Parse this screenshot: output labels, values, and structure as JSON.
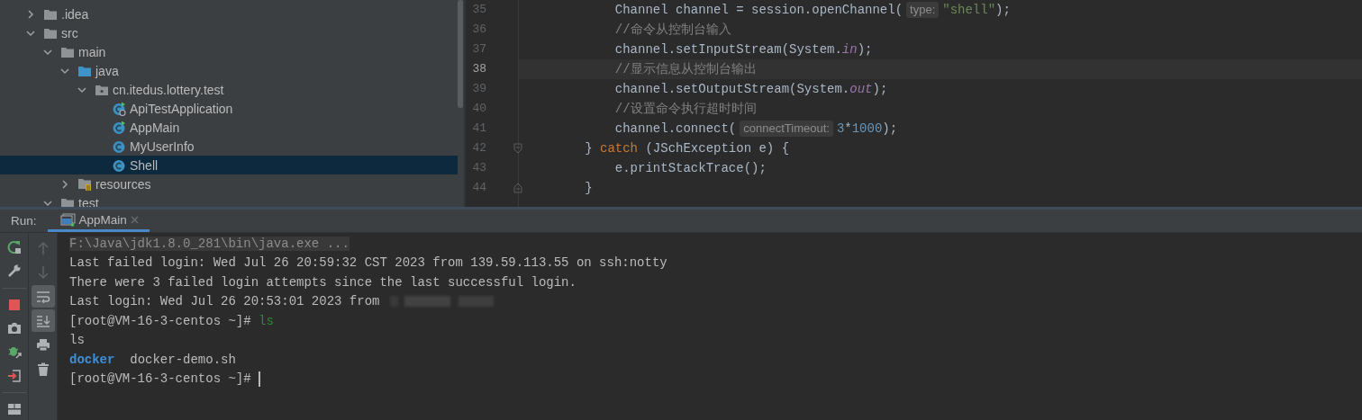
{
  "project_tree": [
    {
      "name": ".idea",
      "kind": "folder",
      "expanded": false,
      "selected": false
    },
    {
      "name": "src",
      "kind": "folder",
      "expanded": true,
      "selected": false,
      "children": [
        {
          "name": "main",
          "kind": "folder",
          "expanded": true,
          "selected": false,
          "children": [
            {
              "name": "java",
              "kind": "source-folder",
              "expanded": true,
              "selected": false,
              "children": [
                {
                  "name": "cn.itedus.lottery.test",
                  "kind": "package",
                  "expanded": true,
                  "selected": false,
                  "children": [
                    {
                      "name": "ApiTestApplication",
                      "kind": "spring-main-class",
                      "selected": false
                    },
                    {
                      "name": "AppMain",
                      "kind": "main-class",
                      "selected": false
                    },
                    {
                      "name": "MyUserInfo",
                      "kind": "class",
                      "selected": false
                    },
                    {
                      "name": "Shell",
                      "kind": "class",
                      "selected": true
                    }
                  ]
                }
              ]
            },
            {
              "name": "resources",
              "kind": "resources-folder",
              "expanded": false,
              "selected": false
            }
          ]
        },
        {
          "name": "test",
          "kind": "folder",
          "expanded": true,
          "selected": false
        }
      ]
    }
  ],
  "editor": {
    "lines": [
      {
        "number": "35",
        "current": false,
        "segments": [
          {
            "kind": "plain",
            "text": "            Channel channel = session.openChannel("
          },
          {
            "kind": "hint",
            "text": "type:"
          },
          {
            "kind": "string",
            "text": "\"shell\""
          },
          {
            "kind": "plain",
            "text": ");"
          }
        ]
      },
      {
        "number": "36",
        "current": false,
        "segments": [
          {
            "kind": "comment",
            "text": "            //命令从控制台输入"
          }
        ]
      },
      {
        "number": "37",
        "current": false,
        "segments": [
          {
            "kind": "plain",
            "text": "            channel.setInputStream(System."
          },
          {
            "kind": "field",
            "text": "in"
          },
          {
            "kind": "plain",
            "text": ");"
          }
        ]
      },
      {
        "number": "38",
        "current": true,
        "segments": [
          {
            "kind": "comment",
            "text": "            //显示信息从控制台输出"
          }
        ]
      },
      {
        "number": "39",
        "current": false,
        "segments": [
          {
            "kind": "plain",
            "text": "            channel.setOutputStream(System."
          },
          {
            "kind": "field",
            "text": "out"
          },
          {
            "kind": "plain",
            "text": ");"
          }
        ]
      },
      {
        "number": "40",
        "current": false,
        "segments": [
          {
            "kind": "comment",
            "text": "            //设置命令执行超时时间"
          }
        ]
      },
      {
        "number": "41",
        "current": false,
        "segments": [
          {
            "kind": "plain",
            "text": "            channel.connect("
          },
          {
            "kind": "hint",
            "text": "connectTimeout:"
          },
          {
            "kind": "number",
            "text": "3"
          },
          {
            "kind": "plain",
            "text": "*"
          },
          {
            "kind": "number",
            "text": "1000"
          },
          {
            "kind": "plain",
            "text": ");"
          }
        ]
      },
      {
        "number": "42",
        "current": false,
        "fold_start": true,
        "segments": [
          {
            "kind": "plain",
            "text": "        } "
          },
          {
            "kind": "keyword",
            "text": "catch"
          },
          {
            "kind": "plain",
            "text": " (JSchException e) {"
          }
        ]
      },
      {
        "number": "43",
        "current": false,
        "segments": [
          {
            "kind": "plain",
            "text": "            e.printStackTrace();"
          }
        ]
      },
      {
        "number": "44",
        "current": false,
        "fold_end": true,
        "segments": [
          {
            "kind": "plain",
            "text": "        }"
          }
        ]
      }
    ]
  },
  "run_panel": {
    "label": "Run:",
    "tabs": [
      {
        "title": "AppMain",
        "selected": true
      }
    ],
    "left_toolbar": [
      {
        "kind": "rerun"
      },
      {
        "kind": "settings"
      },
      {
        "kind": "separator"
      },
      {
        "kind": "stop"
      },
      {
        "kind": "camera"
      },
      {
        "kind": "debug-attach"
      },
      {
        "kind": "exit"
      },
      {
        "kind": "separator"
      },
      {
        "kind": "layout"
      }
    ],
    "right_toolbar": [
      {
        "kind": "up",
        "disabled": true,
        "on": false
      },
      {
        "kind": "down",
        "disabled": true,
        "on": false
      },
      {
        "kind": "soft-wrap",
        "disabled": false,
        "on": true
      },
      {
        "kind": "scroll-to-end",
        "disabled": false,
        "on": true
      },
      {
        "kind": "print",
        "disabled": false,
        "on": false
      },
      {
        "kind": "trash",
        "disabled": false,
        "on": false
      }
    ],
    "console": [
      {
        "kind": "command",
        "segments": [
          {
            "kind": "system",
            "text": "F:\\Java\\jdk1.8.0_281\\bin\\java.exe ..."
          }
        ]
      },
      {
        "kind": "output",
        "segments": [
          {
            "kind": "output",
            "text": "Last failed login: Wed Jul 26 20:59:32 CST 2023 from 139.59.113.55 on ssh:notty"
          }
        ]
      },
      {
        "kind": "output",
        "segments": [
          {
            "kind": "output",
            "text": "There were 3 failed login attempts since the last successful login."
          }
        ]
      },
      {
        "kind": "output",
        "redacted": true,
        "segments": [
          {
            "kind": "output",
            "text": "Last login: Wed Jul 26 20:53:01 2023 from"
          }
        ]
      },
      {
        "kind": "output",
        "segments": [
          {
            "kind": "output",
            "text": "[root@VM-16-3-centos ~]# "
          },
          {
            "kind": "input",
            "text": "ls"
          }
        ]
      },
      {
        "kind": "output",
        "segments": [
          {
            "kind": "output",
            "text": "ls"
          }
        ]
      },
      {
        "kind": "output",
        "segments": [
          {
            "kind": "directory",
            "text": "docker"
          },
          {
            "kind": "output",
            "text": "  docker-demo.sh"
          }
        ]
      },
      {
        "kind": "output",
        "cursor": true,
        "segments": [
          {
            "kind": "output",
            "text": "[root@VM-16-3-centos ~]# "
          }
        ]
      }
    ]
  }
}
